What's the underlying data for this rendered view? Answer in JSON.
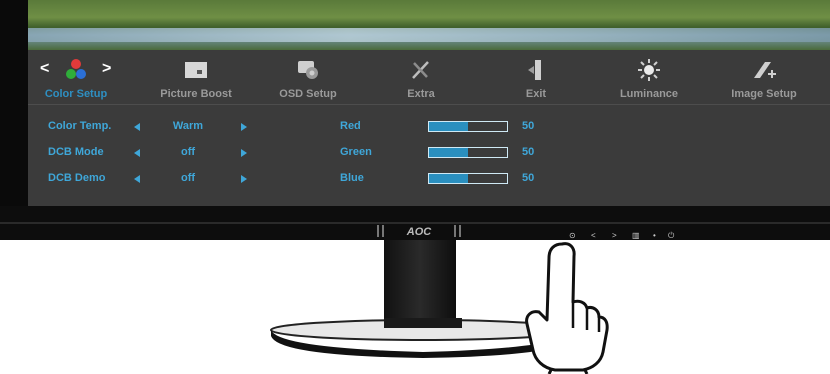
{
  "osd": {
    "menu": [
      {
        "label": "Color Setup",
        "icon": "color-setup-icon",
        "active": true
      },
      {
        "label": "Picture Boost",
        "icon": "picture-boost-icon",
        "active": false
      },
      {
        "label": "OSD Setup",
        "icon": "osd-setup-icon",
        "active": false
      },
      {
        "label": "Extra",
        "icon": "extra-icon",
        "active": false
      },
      {
        "label": "Exit",
        "icon": "exit-icon",
        "active": false
      },
      {
        "label": "Luminance",
        "icon": "luminance-icon",
        "active": false
      },
      {
        "label": "Image Setup",
        "icon": "image-setup-icon",
        "active": false
      }
    ],
    "nav_left": "<",
    "nav_right": ">",
    "settings": [
      {
        "label": "Color Temp.",
        "value": "Warm"
      },
      {
        "label": "DCB Mode",
        "value": "off"
      },
      {
        "label": "DCB Demo",
        "value": "off"
      }
    ],
    "rgb": [
      {
        "label": "Red",
        "value": "50",
        "level": 0.5
      },
      {
        "label": "Green",
        "value": "50",
        "level": 0.5
      },
      {
        "label": "Blue",
        "value": "50",
        "level": 0.5
      }
    ]
  },
  "monitor": {
    "brand": "AOC",
    "buttons": [
      "⊙",
      "<",
      ">",
      "▥",
      "•",
      "⏻"
    ]
  },
  "colors": {
    "active_accent": "#2e8fc2",
    "setting_text": "#3fa7d9",
    "bar_fill": "#2a8fbf",
    "osd_background": "#3b3b3b"
  }
}
